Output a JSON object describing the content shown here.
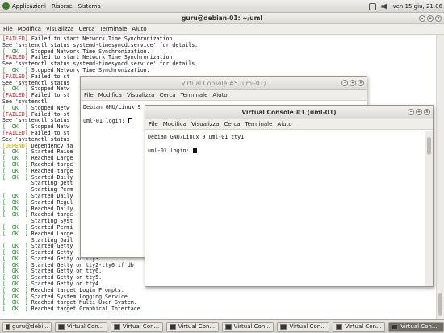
{
  "top_panel": {
    "menus": [
      "Applicazioni",
      "Risorse",
      "Sistema"
    ],
    "title": "guru@debian-01: ~/uml",
    "clock": "ven 15 giu, 21.06"
  },
  "main_terminal": {
    "menu": [
      "File",
      "Modifica",
      "Visualizza",
      "Cerca",
      "Terminale",
      "Aiuto"
    ],
    "lines": [
      [
        "[FAILED]",
        "failed",
        " Failed to start Network Time Synchronization."
      ],
      [
        "",
        "",
        "See 'systemctl status systemd-timesyncd.service' for details."
      ],
      [
        "[  OK  ]",
        "ok",
        " Stopped Network Time Synchronization."
      ],
      [
        "[FAILED]",
        "failed",
        " Failed to start Network Time Synchronization."
      ],
      [
        "",
        "",
        "See 'systemctl status systemd-timesyncd.service' for details."
      ],
      [
        "[  OK  ]",
        "ok",
        " Stopped Network Time Synchronization."
      ],
      [
        "[FAILED]",
        "failed",
        " Failed to st"
      ],
      [
        "",
        "",
        "See 'systemctl status"
      ],
      [
        "[  OK  ]",
        "ok",
        " Stopped Netw"
      ],
      [
        "[FAILED]",
        "failed",
        " Failed to st"
      ],
      [
        "",
        "",
        "See 'systemctl"
      ],
      [
        "[  OK  ]",
        "ok",
        " Stopped Netw"
      ],
      [
        "[FAILED]",
        "failed",
        " Failed to st"
      ],
      [
        "",
        "",
        "See 'systemctl status"
      ],
      [
        "[  OK  ]",
        "ok",
        " Stopped Netw"
      ],
      [
        "[FAILED]",
        "failed",
        " Failed to st"
      ],
      [
        "",
        "",
        "See 'systemctl status"
      ],
      [
        "[DEPEND]",
        "depend",
        " Dependency fa"
      ],
      [
        "[  OK  ]",
        "ok",
        " Started Raise"
      ],
      [
        "[  OK  ]",
        "ok",
        " Reached Large"
      ],
      [
        "[  OK  ]",
        "ok",
        " Reached targe"
      ],
      [
        "[  OK  ]",
        "ok",
        " Reached targe"
      ],
      [
        "[  OK  ]",
        "ok",
        " Started Daily"
      ],
      [
        "",
        "",
        "         Starting gett"
      ],
      [
        "",
        "",
        "         Starting Perm"
      ],
      [
        "[  OK  ]",
        "ok",
        " Started Daily"
      ],
      [
        "[  OK  ]",
        "ok",
        " Started Regul"
      ],
      [
        "[  OK  ]",
        "ok",
        " Reached Daily"
      ],
      [
        "[  OK  ]",
        "ok",
        " Reached targe"
      ],
      [
        "",
        "",
        "         Starting Syst"
      ],
      [
        "[  OK  ]",
        "ok",
        " Started Permi"
      ],
      [
        "[  OK  ]",
        "ok",
        " Reached Large"
      ],
      [
        "",
        "",
        "         Starting Dail"
      ],
      [
        "[  OK  ]",
        "ok",
        " Started Getty"
      ],
      [
        "[  OK  ]",
        "ok",
        " Started Getty"
      ],
      [
        "[  OK  ]",
        "ok",
        " Started Getty on tty3."
      ],
      [
        "[  OK  ]",
        "ok",
        " Started Getty on tty2-tty6 if db"
      ],
      [
        "[  OK  ]",
        "ok",
        " Started Getty on tty6."
      ],
      [
        "[  OK  ]",
        "ok",
        " Started Getty on tty5."
      ],
      [
        "[  OK  ]",
        "ok",
        " Started Getty on tty4."
      ],
      [
        "[  OK  ]",
        "ok",
        " Reached target Login Prompts."
      ],
      [
        "[  OK  ]",
        "ok",
        " Started System Logging Service."
      ],
      [
        "[  OK  ]",
        "ok",
        " Reached target Multi-User System."
      ],
      [
        "[  OK  ]",
        "ok",
        " Reached target Graphical Interface."
      ]
    ]
  },
  "console5": {
    "title": "Virtual Console #5 (uml-01)",
    "menu": [
      "File",
      "Modifica",
      "Visualizza",
      "Cerca",
      "Terminale",
      "Aiuto"
    ],
    "lines": [
      "Debian GNU/Linux 9",
      "",
      "uml-01 login: "
    ]
  },
  "console1": {
    "title": "Virtual Console #1 (uml-01)",
    "menu": [
      "File",
      "Modifica",
      "Visualizza",
      "Cerca",
      "Terminale",
      "Aiuto"
    ],
    "lines": [
      "Debian GNU/Linux 9 uml-01 tty1",
      "",
      "uml-01 login: "
    ]
  },
  "taskbar": {
    "items": [
      "guru@debi...",
      "Virtual Con...",
      "Virtual Con...",
      "Virtual Con...",
      "Virtual Con...",
      "Virtual Con...",
      "Virtual Con...",
      "Virtual Con..."
    ],
    "active_index": 7
  },
  "colors": {
    "failed": "#c01c1c",
    "ok": "#1e8a1e",
    "depend": "#c8a000"
  }
}
